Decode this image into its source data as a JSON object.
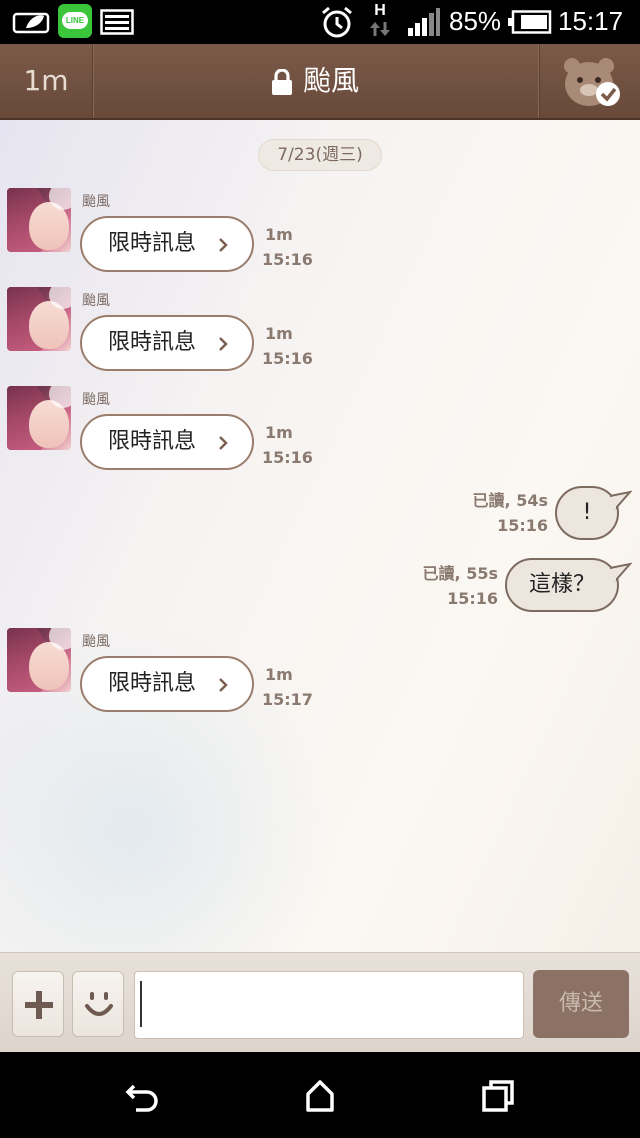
{
  "status_bar": {
    "battery_percent": "85%",
    "time": "15:17",
    "network_label": "H",
    "icons": [
      "leaf-icon",
      "line-app-icon",
      "image-icon",
      "alarm-icon",
      "data-arrows-icon",
      "signal-icon",
      "battery-icon"
    ]
  },
  "header": {
    "back_label": "1m",
    "title": "颱風",
    "lock_icon": "lock-icon",
    "right_icon": "bear-check-icon",
    "colors": {
      "bar": "#6f4f3f"
    }
  },
  "chat": {
    "date_label": "7/23(週三)",
    "incoming": [
      {
        "sender": "颱風",
        "text": "限時訊息",
        "timer": "1m",
        "time": "15:16"
      },
      {
        "sender": "颱風",
        "text": "限時訊息",
        "timer": "1m",
        "time": "15:16"
      },
      {
        "sender": "颱風",
        "text": "限時訊息",
        "timer": "1m",
        "time": "15:16"
      },
      {
        "sender": "颱風",
        "text": "限時訊息",
        "timer": "1m",
        "time": "15:17"
      }
    ],
    "outgoing": [
      {
        "text": "!",
        "status": "已讀, 54s",
        "time": "15:16"
      },
      {
        "text": "這樣？",
        "status": "已讀, 55s",
        "time": "15:16"
      }
    ]
  },
  "input_bar": {
    "plus_icon": "plus-icon",
    "emoji_icon": "smiley-icon",
    "message_value": "",
    "send_label": "傳送"
  },
  "nav_bar": {
    "icons": [
      "back-icon",
      "home-icon",
      "recent-apps-icon"
    ]
  }
}
